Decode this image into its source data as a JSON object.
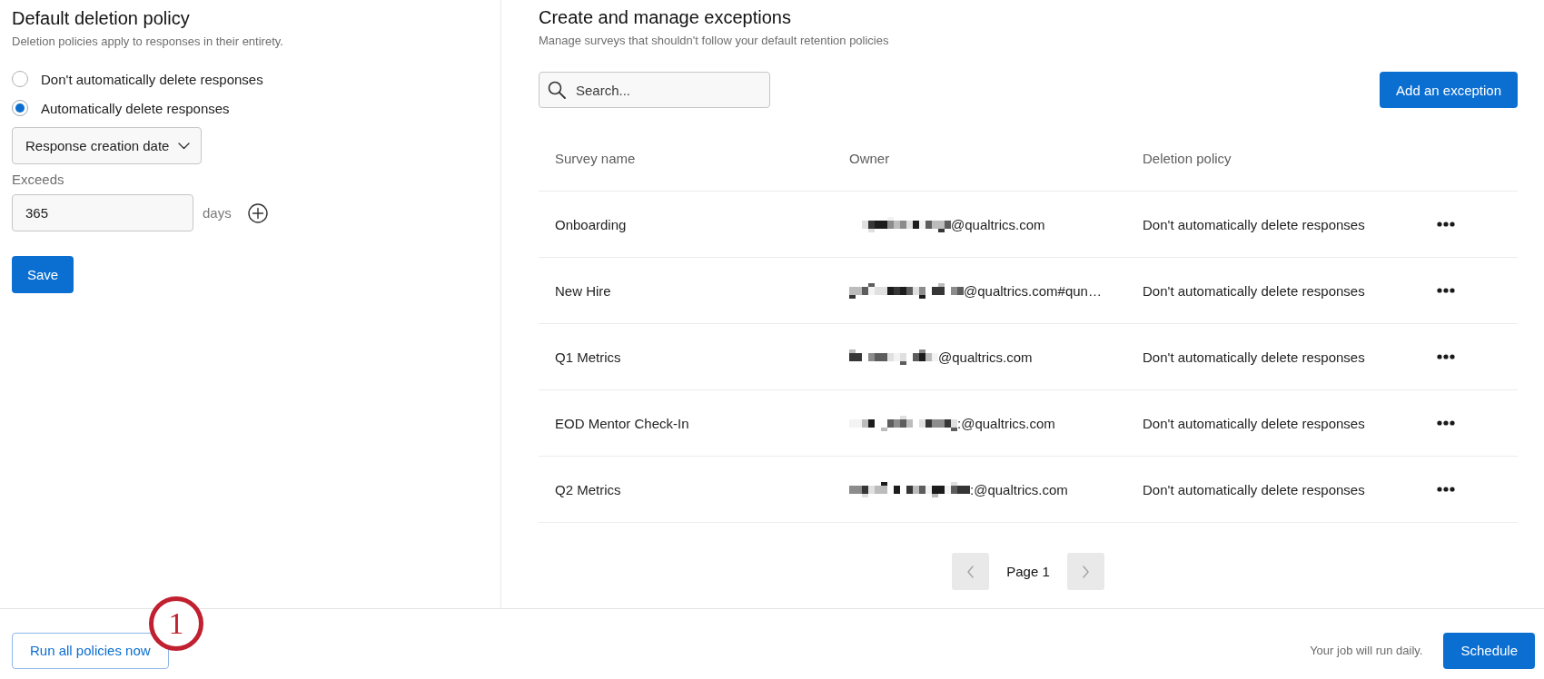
{
  "policy_panel": {
    "title": "Default deletion policy",
    "subtitle": "Deletion policies apply to responses in their entirety.",
    "options": [
      {
        "label": "Don't automatically delete responses",
        "selected": false
      },
      {
        "label": "Automatically delete responses",
        "selected": true
      }
    ],
    "date_field": {
      "value": "Response creation date"
    },
    "exceeds": {
      "label": "Exceeds",
      "value": "365",
      "unit": "days"
    },
    "save_button": "Save"
  },
  "exceptions": {
    "title": "Create and manage exceptions",
    "subtitle": "Manage surveys that shouldn't follow your default retention policies",
    "search": {
      "placeholder": "Search..."
    },
    "add_button": "Add an exception",
    "table": {
      "columns": [
        "Survey name",
        "Owner",
        "Deletion policy"
      ],
      "rows": [
        {
          "survey_name": "Onboarding",
          "owner": "@qualtrics.com",
          "owner_redacted": true,
          "deletion_policy": "Don't automatically delete responses"
        },
        {
          "survey_name": "New Hire",
          "owner": "@qualtrics.com#qun…",
          "owner_redacted": true,
          "deletion_policy": "Don't automatically delete responses"
        },
        {
          "survey_name": "Q1 Metrics",
          "owner": "@qualtrics.com",
          "owner_redacted": true,
          "deletion_policy": "Don't automatically delete responses"
        },
        {
          "survey_name": "EOD Mentor Check-In",
          "owner": ":@qualtrics.com",
          "owner_redacted": true,
          "deletion_policy": "Don't automatically delete responses"
        },
        {
          "survey_name": "Q2 Metrics",
          "owner": ":@qualtrics.com",
          "owner_redacted": true,
          "deletion_policy": "Don't automatically delete responses"
        }
      ]
    },
    "pagination": {
      "label": "Page 1",
      "previous": {
        "disabled": true
      },
      "next": {
        "disabled": true
      }
    }
  },
  "footer": {
    "run_button": "Run all policies now",
    "callout": "1",
    "note": "Your job will run daily.",
    "schedule_button": "Schedule"
  }
}
